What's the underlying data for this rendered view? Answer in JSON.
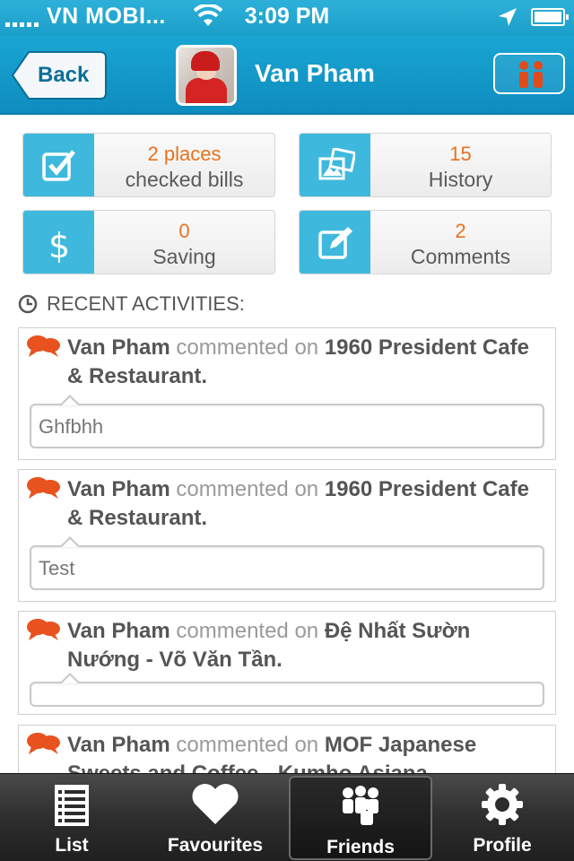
{
  "status_bar": {
    "carrier": "VN MOBI...",
    "time": "3:09 PM"
  },
  "nav": {
    "back_label": "Back",
    "title": "Van Pham"
  },
  "stats": [
    {
      "value": "2 places",
      "label": "checked bills",
      "icon": "checkbox-icon"
    },
    {
      "value": "15",
      "label": "History",
      "icon": "photos-icon"
    },
    {
      "value": "0",
      "label": "Saving",
      "icon": "dollar-icon"
    },
    {
      "value": "2",
      "label": "Comments",
      "icon": "edit-icon"
    }
  ],
  "recent": {
    "heading": "RECENT ACTIVITIES:"
  },
  "activities": [
    {
      "user": "Van Pham",
      "verb": "commented on",
      "place": "1960 President Cafe & Restaurant.",
      "comment": "Ghfbhh"
    },
    {
      "user": "Van Pham",
      "verb": "commented on",
      "place": "1960 President Cafe & Restaurant.",
      "comment": "Test"
    },
    {
      "user": "Van Pham",
      "verb": "commented on",
      "place": "Đệ Nhất Sườn Nướng - Võ Văn Tần.",
      "comment": ""
    },
    {
      "user": "Van Pham",
      "verb": "commented on",
      "place": "MOF Japanese Sweets and Coffee - Kumho Asiana",
      "comment": ""
    }
  ],
  "tabs": [
    {
      "label": "List",
      "icon": "list-icon"
    },
    {
      "label": "Favourites",
      "icon": "heart-icon"
    },
    {
      "label": "Friends",
      "icon": "friends-icon",
      "active": true
    },
    {
      "label": "Profile",
      "icon": "gear-icon"
    }
  ],
  "colors": {
    "accent": "#1aa3d0",
    "orange": "#e8721c",
    "tile_icon": "#3eb9dd"
  }
}
